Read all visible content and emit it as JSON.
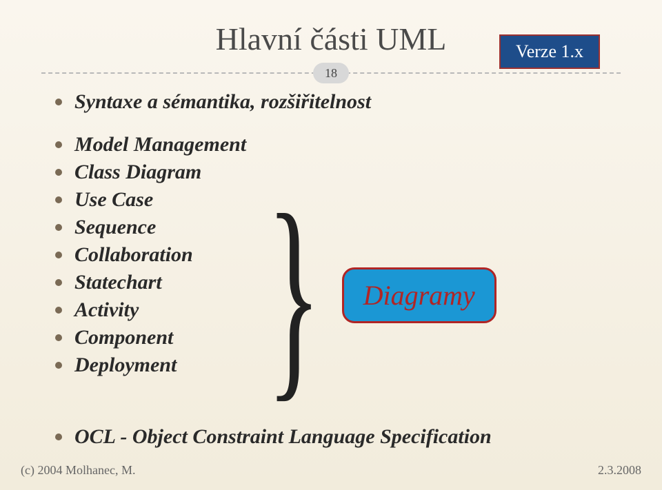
{
  "title": "Hlavní části UML",
  "version_badge": "Verze 1.x",
  "slide_number": "18",
  "subtitle": "Syntaxe a sémantika, rozšiřitelnost",
  "items": [
    "Model Management",
    "Class Diagram",
    "Use Case",
    "Sequence",
    "Collaboration",
    "Statechart",
    "Activity",
    "Component",
    "Deployment"
  ],
  "diagram_label": "Diagramy",
  "bottom_line": "OCL - Object Constraint Language Specification",
  "footer_left": "(c) 2004 Molhanec, M.",
  "footer_right": "2.3.2008"
}
